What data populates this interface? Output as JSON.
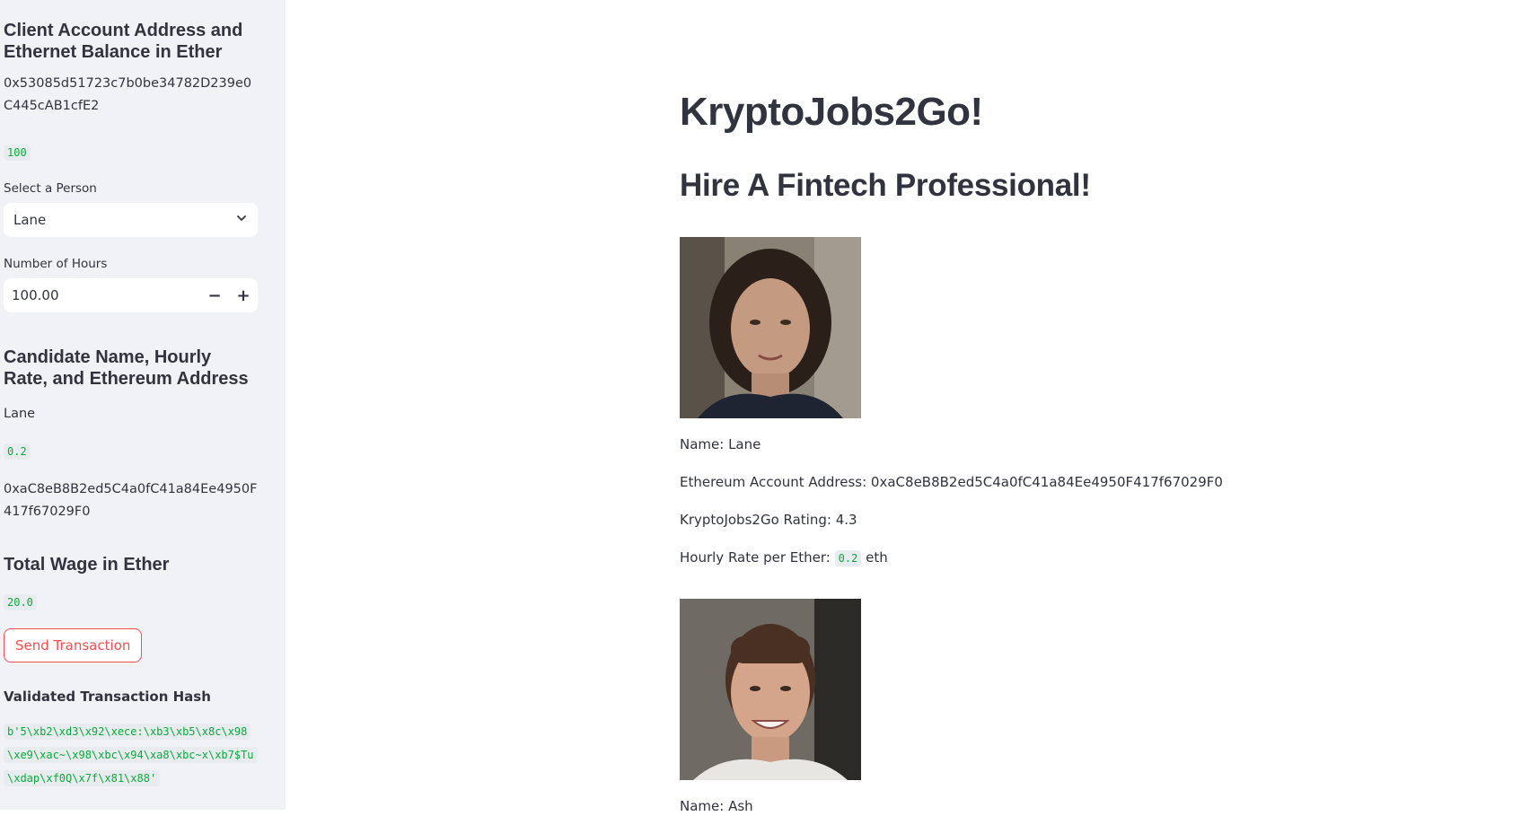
{
  "sidebar": {
    "client_header": "Client Account Address and Ethernet Balance in Ether",
    "client_address": "0x53085d51723c7b0be34782D239e0C445cAB1cfE2",
    "client_balance": "100",
    "select_label": "Select a Person",
    "select_value": "Lane",
    "hours_label": "Number of Hours",
    "hours_value": "100.00",
    "stepper_minus": "−",
    "stepper_plus": "+",
    "candidate_header": "Candidate Name, Hourly Rate, and Ethereum Address",
    "candidate_name": "Lane",
    "candidate_rate": "0.2",
    "candidate_address": "0xaC8eB8B2ed5C4a0fC41a84Ee4950F417f67029F0",
    "wage_header": "Total Wage in Ether",
    "wage_value": "20.0",
    "send_button": "Send Transaction",
    "hash_header": "Validated Transaction Hash",
    "hash_value": "b'5\\xb2\\xd3\\x92\\xece:\\xb3\\xb5\\x8c\\x98\\xe9\\xac~\\x98\\xbc\\x94\\xa8\\xbc~x\\xb7$Tu\\xdap\\xf0Q\\x7f\\x81\\x88'"
  },
  "main": {
    "title": "KryptoJobs2Go!",
    "subtitle": "Hire A Fintech Professional!",
    "candidates": [
      {
        "name_line": "Name: Lane",
        "address_line": "Ethereum Account Address: 0xaC8eB8B2ed5C4a0fC41a84Ee4950F417f67029F0",
        "rating_line": "KryptoJobs2Go Rating: 4.3",
        "rate_prefix": "Hourly Rate per Ether:",
        "rate_value": "0.2",
        "rate_suffix": "eth"
      },
      {
        "name_line": "Name: Ash"
      }
    ]
  },
  "icons": {
    "select_chevron": "chevron-down-icon"
  },
  "colors": {
    "sidebar_bg": "#f0f2f6",
    "accent_red": "#ff4b4b",
    "code_green": "#09ab3b",
    "text": "#31333f"
  }
}
